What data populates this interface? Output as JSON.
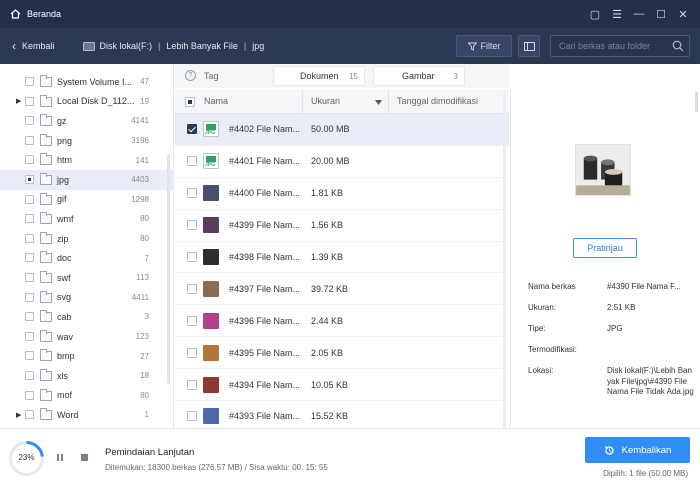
{
  "titlebar": {
    "title": "Beranda",
    "controls": [
      "▢",
      "☰",
      "—",
      "☐",
      "✕"
    ]
  },
  "nav": {
    "back_label": "Kembali",
    "breadcrumb": [
      "Disk lokal(F:)",
      "Lebih Banyak File",
      "jpg"
    ],
    "filter_label": "Filter",
    "search_placeholder": "Cari berkas atau folder"
  },
  "sidebar": {
    "items": [
      {
        "name": "System Volume I...",
        "count": "47",
        "expand": false
      },
      {
        "name": "Local Disk D_112...",
        "count": "19",
        "expand": true
      },
      {
        "name": "gz",
        "count": "4141",
        "expand": false
      },
      {
        "name": "png",
        "count": "3196",
        "expand": false
      },
      {
        "name": "htm",
        "count": "141",
        "expand": false
      },
      {
        "name": "jpg",
        "count": "4403",
        "expand": false
      },
      {
        "name": "gif",
        "count": "1298",
        "expand": false
      },
      {
        "name": "wmf",
        "count": "80",
        "expand": false
      },
      {
        "name": "zip",
        "count": "80",
        "expand": false
      },
      {
        "name": "doc",
        "count": "7",
        "expand": false
      },
      {
        "name": "swf",
        "count": "113",
        "expand": false
      },
      {
        "name": "svg",
        "count": "4411",
        "expand": false
      },
      {
        "name": "cab",
        "count": "3",
        "expand": false
      },
      {
        "name": "wav",
        "count": "123",
        "expand": false
      },
      {
        "name": "bmp",
        "count": "27",
        "expand": false
      },
      {
        "name": "xls",
        "count": "18",
        "expand": false
      },
      {
        "name": "mof",
        "count": "80",
        "expand": false
      },
      {
        "name": "Word",
        "count": "1",
        "expand": true
      }
    ]
  },
  "tabs": {
    "tag_label": "Tag",
    "doc_label": "Dokumen",
    "doc_count": "15",
    "img_label": "Gambar",
    "img_count": "3"
  },
  "table": {
    "columns": {
      "name": "Nama",
      "size": "Ukuran",
      "date": "Tanggal dimodifikasi"
    },
    "rows": [
      {
        "name": "#4402 File Nam...",
        "size": "50.00 MB",
        "thumb": "jpg-icon"
      },
      {
        "name": "#4401 File Nam...",
        "size": "20.00 MB",
        "thumb": "jpg-icon"
      },
      {
        "name": "#4400 File Nam...",
        "size": "1.81 KB",
        "thumb": "#48506a"
      },
      {
        "name": "#4399 File Nam...",
        "size": "1.56 KB",
        "thumb": "#5a3d5c"
      },
      {
        "name": "#4398 File Nam...",
        "size": "1.39 KB",
        "thumb": "#2e2e2e"
      },
      {
        "name": "#4397 File Nam...",
        "size": "39.72 KB",
        "thumb": "#8c6a58"
      },
      {
        "name": "#4396 File Nam...",
        "size": "2.44 KB",
        "thumb": "#b0408a"
      },
      {
        "name": "#4395 File Nam...",
        "size": "2.05 KB",
        "thumb": "#b07838"
      },
      {
        "name": "#4394 File Nam...",
        "size": "10.05 KB",
        "thumb": "#8a3a30"
      },
      {
        "name": "#4393 File Nam...",
        "size": "15.52 KB",
        "thumb": "#4a6aa8"
      }
    ]
  },
  "preview": {
    "button_label": "Pratinjau",
    "fields": [
      {
        "label": "Nama berkas",
        "value": "#4390 File Nama F..."
      },
      {
        "label": "Ukuran:",
        "value": "2.51 KB"
      },
      {
        "label": "Tipe:",
        "value": "JPG"
      },
      {
        "label": "Termodifikasi:",
        "value": ""
      },
      {
        "label": "Lokasi:",
        "value": "Disk lokal(F:)\\Lebih Banyak File\\jpg\\#4390 File Nama File Tidak Ada.jpg"
      }
    ]
  },
  "footer": {
    "progress_pct": "23%",
    "progress_fraction": 0.23,
    "scan_title": "Pemindaian Lanjutan",
    "scan_status": "Ditemukan: 18300 berkas (276.57 MB) / Sisa waktu: 00: 15: 55",
    "restore_label": "Kembalikan",
    "selected_text": "Dipilih: 1 file (50.00 MB)"
  },
  "colors": {
    "titlebar": "#252f4c",
    "navbar": "#2d3855",
    "accent": "#2f8ef4"
  }
}
